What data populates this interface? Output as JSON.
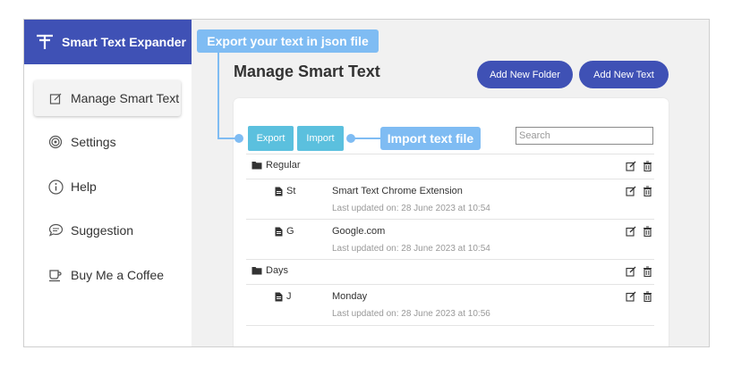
{
  "app": {
    "title": "Smart Text Expander"
  },
  "sidebar": {
    "items": [
      {
        "label": "Manage Smart Text",
        "icon": "edit-icon",
        "active": true
      },
      {
        "label": "Settings",
        "icon": "settings-icon"
      },
      {
        "label": "Help",
        "icon": "help-icon"
      },
      {
        "label": "Suggestion",
        "icon": "chat-icon"
      },
      {
        "label": "Buy Me a Coffee",
        "icon": "coffee-icon"
      }
    ]
  },
  "main": {
    "title": "Manage Smart Text",
    "add_folder_label": "Add New Folder",
    "add_text_label": "Add New Text"
  },
  "toolbar": {
    "export_label": "Export",
    "import_label": "Import",
    "search_placeholder": "Search"
  },
  "annotations": {
    "export_note": "Export your text in json file",
    "import_note": "Import text file"
  },
  "tree": [
    {
      "type": "folder",
      "name": "Regular"
    },
    {
      "type": "file",
      "key": "St",
      "text": "Smart Text Chrome Extension",
      "updated": "Last updated on: 28 June 2023 at 10:54"
    },
    {
      "type": "file",
      "key": "G",
      "text": "Google.com",
      "updated": "Last updated on: 28 June 2023 at 10:54"
    },
    {
      "type": "folder",
      "name": "Days"
    },
    {
      "type": "file",
      "key": "J",
      "text": "Monday",
      "updated": "Last updated on: 28 June 2023 at 10:56"
    }
  ],
  "colors": {
    "brand": "#3f51b5",
    "teal": "#5bc0de",
    "annotation": "#7fbcf3"
  }
}
